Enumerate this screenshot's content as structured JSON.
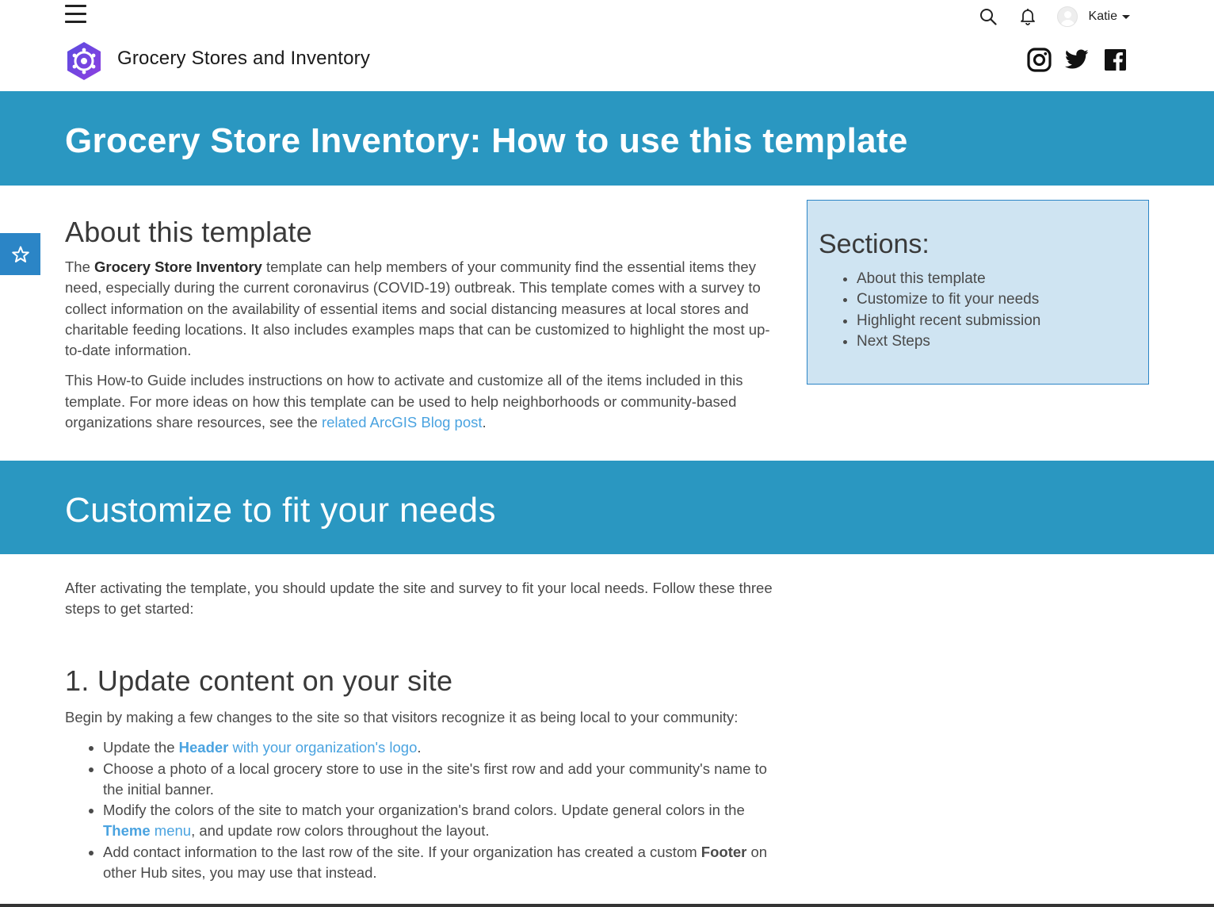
{
  "topbar": {
    "username": "Katie",
    "icons": [
      "hamburger-menu-icon",
      "search-icon",
      "bell-icon",
      "avatar",
      "chevron-down-icon"
    ]
  },
  "site": {
    "title": "Grocery Stores and Inventory",
    "logo_icon": "hub-logo-icon",
    "social_icons": [
      "instagram-icon",
      "twitter-icon",
      "facebook-icon"
    ]
  },
  "banner": {
    "title": "Grocery Store Inventory: How to use this template"
  },
  "favorite": {
    "icon": "star-icon"
  },
  "about": {
    "heading": "About this template",
    "p1_prefix": "The ",
    "p1_bold": "Grocery Store Inventory",
    "p1_rest": " template can help members of your community find the essential items they need, especially during the current coronavirus (COVID-19) outbreak. This template comes with a survey to collect information on the availability of essential items and social distancing measures at local stores and charitable feeding locations. It also includes examples maps that can be customized to highlight the most up-to-date information.",
    "p2_text": "This How-to Guide includes instructions on how to activate and customize all of the items included in this template. For more ideas on how this template can be used to help neighborhoods or community-based organizations share resources, see the ",
    "p2_link": "related ArcGIS Blog post",
    "p2_end": "."
  },
  "sections": {
    "heading": "Sections:",
    "items": [
      "About this template",
      "Customize to fit your needs",
      "Highlight recent submission",
      "Next Steps"
    ]
  },
  "customize": {
    "heading": "Customize to fit your needs",
    "intro": "After activating the template, you should update the site and survey to fit your local needs. Follow these three steps to get started:"
  },
  "step1": {
    "heading": "1. Update content on your site",
    "intro": "Begin by making a few changes to the site so that visitors recognize it as being local to your community:",
    "b1_prefix": "Update the ",
    "b1_link_bold": "Header",
    "b1_link_rest": " with your organization's logo",
    "b1_end": ".",
    "b2": "Choose a photo of a local grocery store to use in the site's first row and add your community's name to the initial banner.",
    "b3_prefix": "Modify the colors of the site to match your organization's brand colors. Update general colors in the ",
    "b3_link_bold": "Theme",
    "b3_link_rest": " menu",
    "b3_end": ", and update row colors throughout the layout.",
    "b4_prefix": "Add contact information to the last row of the site. If your organization has created a custom ",
    "b4_bold": "Footer",
    "b4_end": " on other Hub sites, you may use that instead."
  },
  "colors": {
    "banner": "#2a97c1",
    "link": "#4aa3e0",
    "sections_bg": "#cfe4f2",
    "sections_border": "#2b85c6",
    "logo": "#7b3fe4"
  }
}
